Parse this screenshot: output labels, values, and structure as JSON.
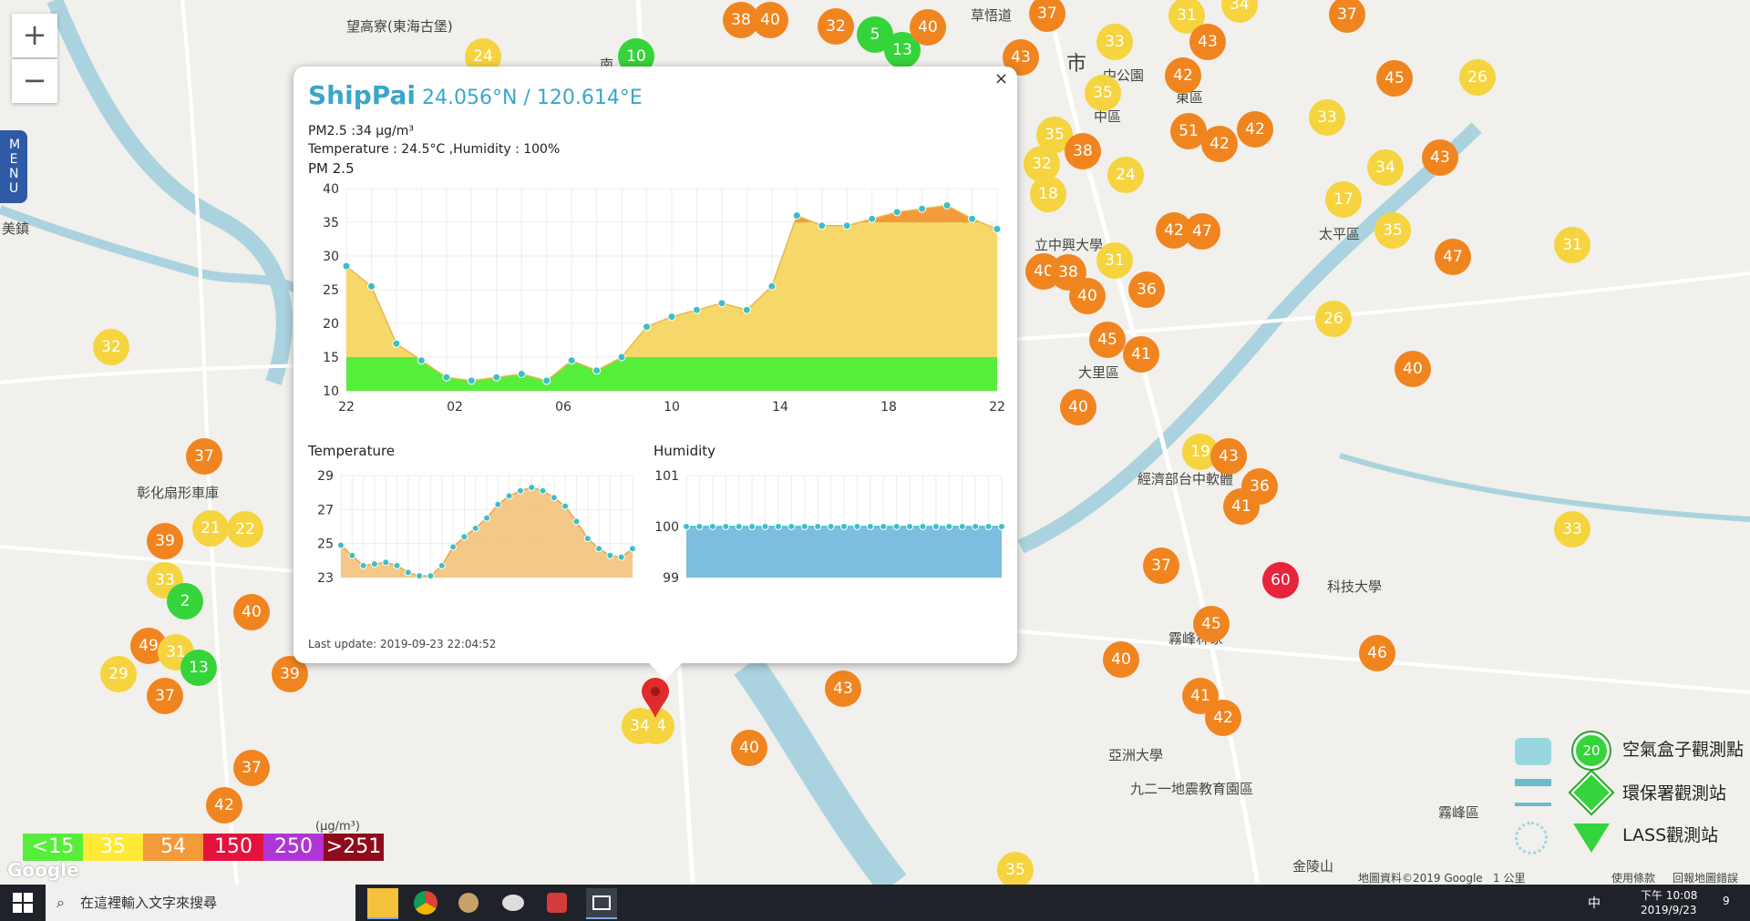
{
  "map": {
    "zoom_in": "+",
    "zoom_out": "−",
    "menu_label": "MENU",
    "places": [
      "望高寮(東海古堡)",
      "南",
      "美鎮",
      "草悟道",
      "東區",
      "太平區",
      "大里區",
      "霧峰區",
      "亞洲大學",
      "九二一地震教育園區",
      "彰化扇形車庫",
      "中區",
      "市",
      "中公園",
      "立中興大學",
      "經濟部台中軟體",
      "霧峰林家",
      "金陵山",
      "科技大學"
    ],
    "google_attribution": "地圖資料©2019 Google",
    "scale_text": "1 公里",
    "terms": "使用條款",
    "report": "回報地圖錯誤",
    "google_logo": "Google",
    "markers": [
      {
        "v": "24",
        "c": "yellow"
      },
      {
        "v": "10",
        "c": "green"
      },
      {
        "v": "38",
        "c": "orange"
      },
      {
        "v": "40",
        "c": "orange"
      },
      {
        "v": "32",
        "c": "orange"
      },
      {
        "v": "5",
        "c": "green"
      },
      {
        "v": "13",
        "c": "green"
      },
      {
        "v": "40",
        "c": "orange"
      },
      {
        "v": "37",
        "c": "orange"
      },
      {
        "v": "43",
        "c": "orange"
      },
      {
        "v": "33",
        "c": "yellow"
      },
      {
        "v": "31",
        "c": "yellow"
      },
      {
        "v": "34",
        "c": "yellow"
      },
      {
        "v": "37",
        "c": "orange"
      },
      {
        "v": "43",
        "c": "orange"
      },
      {
        "v": "42",
        "c": "orange"
      },
      {
        "v": "35",
        "c": "yellow"
      },
      {
        "v": "45",
        "c": "orange"
      },
      {
        "v": "26",
        "c": "yellow"
      },
      {
        "v": "33",
        "c": "yellow"
      },
      {
        "v": "51",
        "c": "orange"
      },
      {
        "v": "42",
        "c": "orange"
      },
      {
        "v": "42",
        "c": "orange"
      },
      {
        "v": "35",
        "c": "yellow"
      },
      {
        "v": "38",
        "c": "orange"
      },
      {
        "v": "32",
        "c": "yellow"
      },
      {
        "v": "24",
        "c": "yellow"
      },
      {
        "v": "18",
        "c": "yellow"
      },
      {
        "v": "34",
        "c": "yellow"
      },
      {
        "v": "43",
        "c": "orange"
      },
      {
        "v": "17",
        "c": "yellow"
      },
      {
        "v": "35",
        "c": "yellow"
      },
      {
        "v": "42",
        "c": "orange"
      },
      {
        "v": "47",
        "c": "orange"
      },
      {
        "v": "40",
        "c": "orange"
      },
      {
        "v": "38",
        "c": "orange"
      },
      {
        "v": "31",
        "c": "yellow"
      },
      {
        "v": "40",
        "c": "orange"
      },
      {
        "v": "36",
        "c": "orange"
      },
      {
        "v": "26",
        "c": "yellow"
      },
      {
        "v": "45",
        "c": "orange"
      },
      {
        "v": "41",
        "c": "orange"
      },
      {
        "v": "40",
        "c": "orange"
      },
      {
        "v": "31",
        "c": "yellow"
      },
      {
        "v": "47",
        "c": "orange"
      },
      {
        "v": "40",
        "c": "orange"
      },
      {
        "v": "19",
        "c": "yellow"
      },
      {
        "v": "43",
        "c": "orange"
      },
      {
        "v": "36",
        "c": "orange"
      },
      {
        "v": "41",
        "c": "orange"
      },
      {
        "v": "37",
        "c": "orange"
      },
      {
        "v": "60",
        "c": "red"
      },
      {
        "v": "45",
        "c": "orange"
      },
      {
        "v": "43",
        "c": "orange"
      },
      {
        "v": "40",
        "c": "orange"
      },
      {
        "v": "46",
        "c": "orange"
      },
      {
        "v": "41",
        "c": "orange"
      },
      {
        "v": "42",
        "c": "orange"
      },
      {
        "v": "33",
        "c": "yellow"
      },
      {
        "v": "40",
        "c": "orange"
      },
      {
        "v": "35",
        "c": "yellow"
      },
      {
        "v": "34",
        "c": "yellow"
      },
      {
        "v": "32",
        "c": "yellow"
      },
      {
        "v": "37",
        "c": "orange"
      },
      {
        "v": "39",
        "c": "orange"
      },
      {
        "v": "21",
        "c": "yellow"
      },
      {
        "v": "22",
        "c": "yellow"
      },
      {
        "v": "33",
        "c": "yellow"
      },
      {
        "v": "2",
        "c": "green"
      },
      {
        "v": "40",
        "c": "orange"
      },
      {
        "v": "49",
        "c": "orange"
      },
      {
        "v": "31",
        "c": "yellow"
      },
      {
        "v": "13",
        "c": "green"
      },
      {
        "v": "29",
        "c": "yellow"
      },
      {
        "v": "37",
        "c": "orange"
      },
      {
        "v": "39",
        "c": "orange"
      },
      {
        "v": "37",
        "c": "orange"
      },
      {
        "v": "42",
        "c": "orange"
      },
      {
        "v": "34",
        "c": "yellow"
      }
    ]
  },
  "popup": {
    "close": "×",
    "station": "ShipPai",
    "coord": "24.056°N / 120.614°E",
    "pm25_line": "PM2.5 :34 μg/m³",
    "temp_line": "Temperature : 24.5°C ,Humidity : 100%",
    "pm_title": "PM 2.5",
    "temp_title": "Temperature",
    "hum_title": "Humidity",
    "last_update": "Last update: 2019-09-23 22:04:52"
  },
  "chart_data": [
    {
      "type": "area",
      "title": "PM 2.5",
      "x_ticks": [
        "22",
        "02",
        "06",
        "10",
        "14",
        "18",
        "22"
      ],
      "ylim": [
        10,
        40
      ],
      "y_ticks": [
        10,
        15,
        20,
        25,
        30,
        35,
        40
      ],
      "values": [
        28.5,
        25.5,
        17,
        14.5,
        12,
        11.5,
        12,
        12.5,
        11.5,
        14.5,
        13,
        15,
        19.5,
        21,
        22,
        23,
        22,
        25.5,
        36,
        34.5,
        34.5,
        35.5,
        36.5,
        37,
        37.5,
        35.5,
        34
      ],
      "thresholds": [
        15,
        35
      ],
      "colors": {
        "low": "#57ee3b",
        "mid": "#f6d76a",
        "high": "#f39a3a",
        "marker": "#3bbfc7"
      }
    },
    {
      "type": "area",
      "title": "Temperature",
      "ylim": [
        23,
        29
      ],
      "y_ticks": [
        23,
        25,
        27,
        29
      ],
      "values": [
        24.9,
        24.3,
        23.7,
        23.8,
        23.9,
        23.7,
        23.3,
        23.1,
        23.1,
        23.7,
        24.8,
        25.4,
        25.9,
        26.5,
        27.3,
        27.8,
        28.1,
        28.3,
        28.1,
        27.7,
        27.2,
        26.3,
        25.3,
        24.7,
        24.3,
        24.2,
        24.7
      ],
      "color": "#f3c27a"
    },
    {
      "type": "area",
      "title": "Humidity",
      "ylim": [
        99,
        101
      ],
      "y_ticks": [
        99,
        100,
        101
      ],
      "values": [
        100,
        100,
        100,
        100,
        100,
        100,
        100,
        100,
        100,
        100,
        100,
        100,
        100,
        100,
        100,
        100,
        100,
        100,
        100,
        100,
        100,
        100,
        100,
        100,
        100
      ],
      "color": "#6fb6da"
    }
  ],
  "scale_bar": {
    "unit": "(μg/m³)",
    "items": [
      {
        "label": "<15",
        "color": "#57ee3b"
      },
      {
        "label": "35",
        "color": "#ffe936"
      },
      {
        "label": "54",
        "color": "#f39a3a"
      },
      {
        "label": "150",
        "color": "#e4133c"
      },
      {
        "label": "250",
        "color": "#b035d6"
      },
      {
        "label": ">251",
        "color": "#8e0c1a"
      }
    ]
  },
  "legend": {
    "value": "20",
    "items": [
      "空氣盒子觀測點",
      "環保署觀測站",
      "LASS觀測站"
    ]
  },
  "taskbar": {
    "search_placeholder": "在這裡輸入文字來搜尋",
    "time": "下午 10:08",
    "date": "2019/9/23",
    "ime": "中",
    "notif": "9"
  }
}
